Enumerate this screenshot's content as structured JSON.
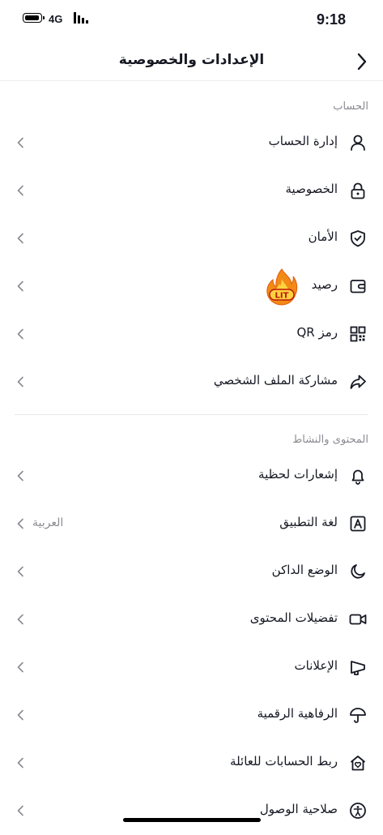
{
  "status": {
    "network": "4G",
    "time": "9:18"
  },
  "header": {
    "title": "الإعدادات والخصوصية"
  },
  "sections": {
    "account": {
      "label": "الحساب",
      "items": [
        {
          "label": "إدارة الحساب",
          "icon": "person-icon"
        },
        {
          "label": "الخصوصية",
          "icon": "lock-icon"
        },
        {
          "label": "الأمان",
          "icon": "shield-check-icon"
        },
        {
          "label": "رصيد",
          "icon": "wallet-icon"
        },
        {
          "label": "رمز QR",
          "icon": "qr-code-icon"
        },
        {
          "label": "مشاركة الملف الشخصي",
          "icon": "share-icon"
        }
      ]
    },
    "content": {
      "label": "المحتوى والنشاط",
      "items": [
        {
          "label": "إشعارات لحظية",
          "icon": "bell-icon"
        },
        {
          "label": "لغة التطبيق",
          "icon": "language-icon",
          "value": "العربية"
        },
        {
          "label": "الوضع الداكن",
          "icon": "moon-icon"
        },
        {
          "label": "تفضيلات المحتوى",
          "icon": "video-camera-icon"
        },
        {
          "label": "الإعلانات",
          "icon": "megaphone-icon"
        },
        {
          "label": "الرفاهية الرقمية",
          "icon": "umbrella-icon"
        },
        {
          "label": "ربط الحسابات للعائلة",
          "icon": "house-heart-icon"
        },
        {
          "label": "صلاحية الوصول",
          "icon": "accessibility-icon"
        }
      ]
    }
  },
  "sticker": {
    "text": "LIT",
    "icon": "fire-emoji-icon"
  }
}
